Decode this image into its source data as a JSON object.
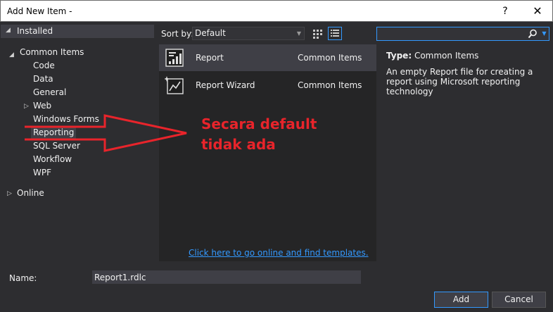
{
  "window": {
    "title": "Add New Item -",
    "help": "?",
    "close": "✕"
  },
  "tree": {
    "installed": "Installed",
    "common_items": "Common Items",
    "children": [
      "Code",
      "Data",
      "General",
      "Web",
      "Windows Forms",
      "Reporting",
      "SQL Server",
      "Workflow",
      "WPF"
    ],
    "online": "Online"
  },
  "toolbar": {
    "sort_by_label": "Sort by:",
    "sort_value": "Default"
  },
  "items": [
    {
      "name": "Report",
      "category": "Common Items"
    },
    {
      "name": "Report Wizard",
      "category": "Common Items"
    }
  ],
  "annotation": {
    "line1": "Secara default",
    "line2": "tidak ada",
    "color": "#e8242b"
  },
  "details": {
    "type_label": "Type:",
    "type_value": "Common Items",
    "description": "An empty Report file for creating a report using Microsoft reporting technology"
  },
  "online_link": "Click here to go online and find templates.",
  "footer": {
    "name_label": "Name:",
    "name_value": "Report1.rdlc",
    "add_label": "Add",
    "cancel_label": "Cancel"
  },
  "colors": {
    "accent": "#3399ff",
    "background": "#2d2d30",
    "panel": "#252526",
    "selection": "#3f3f46"
  }
}
